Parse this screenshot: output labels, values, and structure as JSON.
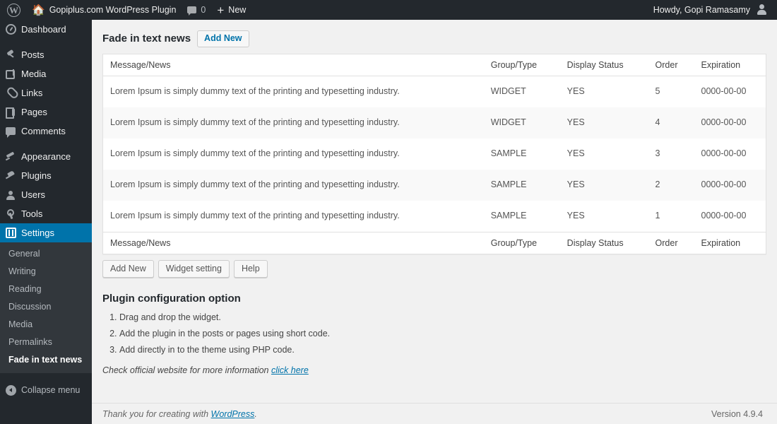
{
  "adminbar": {
    "wp_logo_icon": "wordpress-logo-icon",
    "site_home_icon": "home-icon",
    "site_name": "Gopiplus.com WordPress Plugin",
    "comments_icon": "comment-bubble-icon",
    "comments_count": "0",
    "new_icon": "plus-icon",
    "new_label": "New",
    "howdy": "Howdy, Gopi Ramasamy",
    "avatar_icon": "avatar-icon"
  },
  "sidebar": {
    "items": [
      {
        "label": "Dashboard",
        "icon": "dashboard-icon",
        "icon_class": "ic-dash",
        "sep_after": true
      },
      {
        "label": "Posts",
        "icon": "pin-icon",
        "icon_class": "ic-pin",
        "sep_after": false
      },
      {
        "label": "Media",
        "icon": "media-icon",
        "icon_class": "ic-media",
        "sep_after": false
      },
      {
        "label": "Links",
        "icon": "link-icon",
        "icon_class": "ic-link",
        "sep_after": false
      },
      {
        "label": "Pages",
        "icon": "pages-icon",
        "icon_class": "ic-pages",
        "sep_after": false
      },
      {
        "label": "Comments",
        "icon": "comment-icon",
        "icon_class": "ic-comment",
        "sep_after": true
      },
      {
        "label": "Appearance",
        "icon": "appearance-icon",
        "icon_class": "ic-brush",
        "sep_after": false
      },
      {
        "label": "Plugins",
        "icon": "plugins-icon",
        "icon_class": "ic-plug",
        "sep_after": false
      },
      {
        "label": "Users",
        "icon": "users-icon",
        "icon_class": "ic-user",
        "sep_after": false
      },
      {
        "label": "Tools",
        "icon": "tools-icon",
        "icon_class": "ic-tools",
        "sep_after": false
      },
      {
        "label": "Settings",
        "icon": "settings-icon",
        "icon_class": "ic-settings",
        "sep_after": false,
        "current": true
      }
    ],
    "submenu": [
      {
        "label": "General",
        "current": false
      },
      {
        "label": "Writing",
        "current": false
      },
      {
        "label": "Reading",
        "current": false
      },
      {
        "label": "Discussion",
        "current": false
      },
      {
        "label": "Media",
        "current": false
      },
      {
        "label": "Permalinks",
        "current": false
      },
      {
        "label": "Fade in text news",
        "current": true
      }
    ],
    "collapse_label": "Collapse menu",
    "collapse_icon": "collapse-arrow-icon"
  },
  "page": {
    "title": "Fade in text news",
    "add_new_label": "Add New"
  },
  "table": {
    "columns": [
      {
        "key": "message",
        "label": "Message/News"
      },
      {
        "key": "group",
        "label": "Group/Type"
      },
      {
        "key": "display",
        "label": "Display Status"
      },
      {
        "key": "order",
        "label": "Order"
      },
      {
        "key": "expiration",
        "label": "Expiration"
      }
    ],
    "rows": [
      {
        "message": "Lorem Ipsum is simply dummy text of the printing and typesetting industry.",
        "group": "WIDGET",
        "display": "YES",
        "order": "5",
        "expiration": "0000-00-00"
      },
      {
        "message": "Lorem Ipsum is simply dummy text of the printing and typesetting industry.",
        "group": "WIDGET",
        "display": "YES",
        "order": "4",
        "expiration": "0000-00-00"
      },
      {
        "message": "Lorem Ipsum is simply dummy text of the printing and typesetting industry.",
        "group": "SAMPLE",
        "display": "YES",
        "order": "3",
        "expiration": "0000-00-00"
      },
      {
        "message": "Lorem Ipsum is simply dummy text of the printing and typesetting industry.",
        "group": "SAMPLE",
        "display": "YES",
        "order": "2",
        "expiration": "0000-00-00"
      },
      {
        "message": "Lorem Ipsum is simply dummy text of the printing and typesetting industry.",
        "group": "SAMPLE",
        "display": "YES",
        "order": "1",
        "expiration": "0000-00-00"
      }
    ]
  },
  "actions": {
    "add_new": "Add New",
    "widget_setting": "Widget setting",
    "help": "Help"
  },
  "config": {
    "title": "Plugin configuration option",
    "steps": [
      "Drag and drop the widget.",
      "Add the plugin in the posts or pages using short code.",
      "Add directly in to the theme using PHP code."
    ],
    "note_prefix": "Check official website for more information ",
    "note_link": "click here"
  },
  "footer": {
    "thanks_prefix": "Thank you for creating with ",
    "thanks_link": "WordPress",
    "thanks_suffix": ".",
    "version": "Version 4.9.4"
  },
  "colors": {
    "admin_bar_bg": "#23282d",
    "sidebar_bg": "#23282d",
    "submenu_bg": "#32373c",
    "accent_blue": "#0073aa",
    "content_bg": "#f1f1f1",
    "table_bg": "#ffffff",
    "alt_row_bg": "#f9f9f9"
  }
}
